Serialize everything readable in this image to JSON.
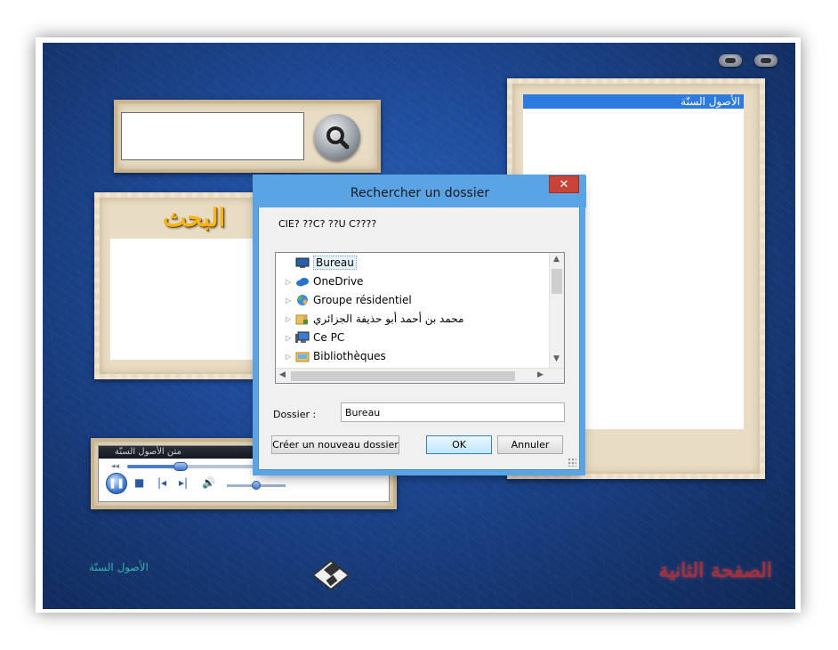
{
  "app": {
    "search_input_value": "",
    "search_heading": "البحث",
    "list_header": "الأصول السنّة",
    "bottom_left_label": "الأصول السنّة",
    "page_label": "الصفحة الثانية",
    "player": {
      "track_title": "متن الأصول السنّة",
      "seek_progress": 0.35,
      "volume": 0.5
    },
    "icons": {
      "search": "magnifier-icon",
      "save": "floppy-disk-icon",
      "minimize": "pill-button-icon",
      "close": "pill-button-icon"
    }
  },
  "dialog": {
    "title": "Rechercher un dossier",
    "close_label": "✕",
    "prompt": "CIE? ??C? ??U C????",
    "tree_items": [
      {
        "label": "Bureau",
        "icon": "desktop-icon",
        "expandable": false,
        "selected": true
      },
      {
        "label": "OneDrive",
        "icon": "cloud-icon",
        "expandable": true,
        "selected": false
      },
      {
        "label": "Groupe résidentiel",
        "icon": "homegroup-icon",
        "expandable": true,
        "selected": false
      },
      {
        "label": "محمد بن أحمد أبو حذيفة الجزائري",
        "icon": "user-folder-icon",
        "expandable": true,
        "selected": false
      },
      {
        "label": "Ce PC",
        "icon": "computer-icon",
        "expandable": true,
        "selected": false
      },
      {
        "label": "Bibliothèques",
        "icon": "library-icon",
        "expandable": true,
        "selected": false
      }
    ],
    "folder_label": "Dossier :",
    "folder_value": "Bureau",
    "new_folder_button": "Créer un nouveau dossier",
    "ok_button": "OK",
    "cancel_button": "Annuler"
  },
  "colors": {
    "dialog_frame": "#5aa4e6",
    "close_red": "#c74436",
    "list_header_blue": "#2d7ae0",
    "heading_gold": "#f4b51c",
    "page_label_red": "#b0313a"
  }
}
